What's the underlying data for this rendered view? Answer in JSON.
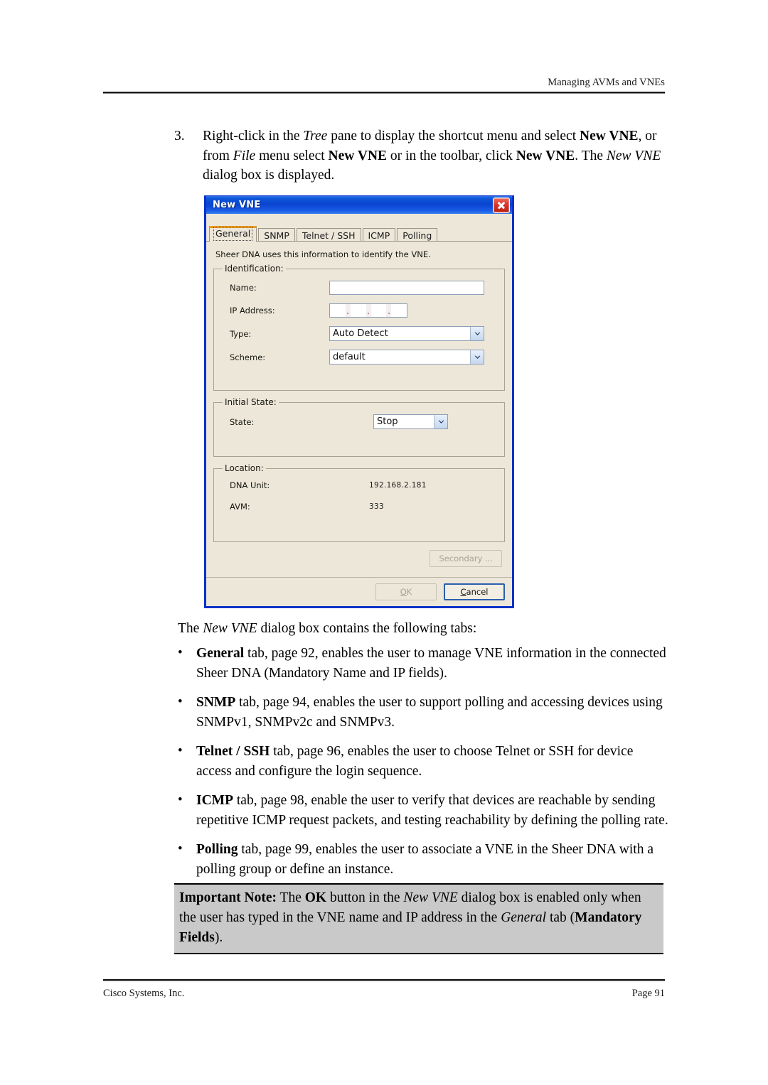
{
  "page": {
    "header_title": "Managing AVMs and VNEs",
    "footer_left": "Cisco Systems, Inc.",
    "footer_right": "Page 91"
  },
  "step": {
    "number": "3.",
    "text_part1": "Right-click in the ",
    "tree_italic": "Tree",
    "text_part2": " pane to display the shortcut menu and select ",
    "new_vne_bold_1": "New VNE",
    "text_part3": ", or from ",
    "file_italic": "File",
    "text_part4": " menu select ",
    "new_vne_bold_2": "New VNE",
    "text_part5": " or in the toolbar, click ",
    "new_vne_bold_3": "New VNE",
    "text_part6": ". The ",
    "new_vne_italic": "New VNE",
    "text_part7": " dialog box is displayed."
  },
  "dialog": {
    "title": "New VNE",
    "close_label": "Close",
    "tabs": [
      {
        "label": "General",
        "selected": true
      },
      {
        "label": "SNMP",
        "selected": false
      },
      {
        "label": "Telnet / SSH",
        "selected": false
      },
      {
        "label": "ICMP",
        "selected": false
      },
      {
        "label": "Polling",
        "selected": false
      }
    ],
    "description": "Sheer DNA uses this information to identify the VNE.",
    "identification": {
      "legend": "Identification:",
      "name_label": "Name:",
      "name_value": "",
      "ip_label": "IP Address:",
      "ip_value": "",
      "type_label": "Type:",
      "type_value": "Auto Detect",
      "scheme_label": "Scheme:",
      "scheme_value": "default"
    },
    "initial_state": {
      "legend": "Initial State:",
      "state_label": "State:",
      "state_value": "Stop"
    },
    "location": {
      "legend": "Location:",
      "dna_unit_label": "DNA Unit:",
      "dna_unit_value": "192.168.2.181",
      "avm_label": "AVM:",
      "avm_value": "333"
    },
    "buttons": {
      "secondary": "Secondary ...",
      "ok": "OK",
      "ok_mnemonic": "O",
      "ok_rest": "K",
      "cancel_mnemonic": "C",
      "cancel_rest": "ancel"
    },
    "colors": {
      "titlebar_blue": "#0a44d0",
      "dialog_face": "#ece7d9",
      "selected_tab_accent": "#f09a1a",
      "close_red": "#d8372a"
    }
  },
  "body": {
    "lead_part1": "The ",
    "lead_italic": "New VNE",
    "lead_part2": " dialog box contains the following tabs:",
    "bullet_char": "•",
    "bullets": [
      {
        "bold": "General",
        "text": " tab, page 92, enables the user to manage VNE information in the connected Sheer DNA (Mandatory Name and IP fields)."
      },
      {
        "bold": "SNMP",
        "text": " tab, page 94, enables the user to support polling and accessing devices using SNMPv1, SNMPv2c and SNMPv3."
      },
      {
        "bold": "Telnet / SSH",
        "text": " tab, page 96, enables the user to choose Telnet or SSH for device access and configure the login sequence."
      },
      {
        "bold": "ICMP",
        "text": " tab, page 98, enable the user to verify that devices are reachable by sending repetitive ICMP request packets, and testing reachability by defining the polling rate."
      },
      {
        "bold": "Polling",
        "text": " tab, page 99, enables the user to associate a VNE in the Sheer DNA with a polling group or define an instance."
      }
    ]
  },
  "note": {
    "label": "Important Note:",
    "part1": " The ",
    "ok_bold": "OK",
    "part2": " button in the ",
    "new_vne_italic": "New VNE",
    "part3": " dialog box is enabled only when the user has typed in the VNE name and IP address in the ",
    "general_italic": "General",
    "part4": " tab (",
    "mandatory_bold": "Mandatory Fields",
    "part5": ")."
  }
}
